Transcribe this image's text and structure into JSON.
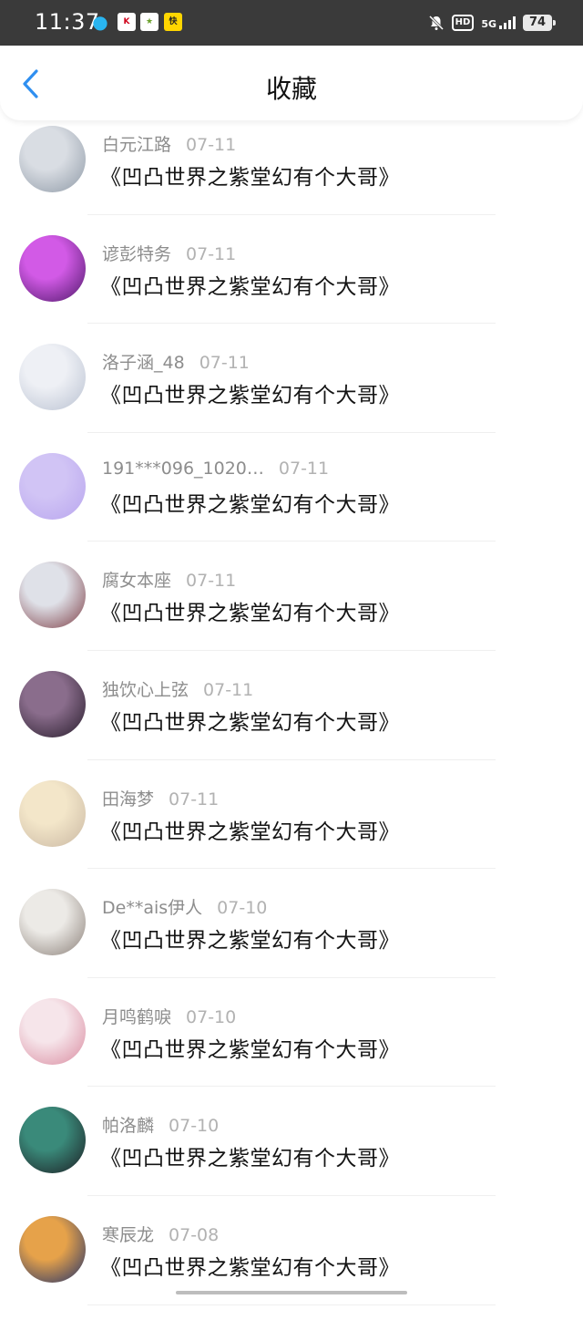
{
  "status_bar": {
    "time": "11:37",
    "network": "5G",
    "hd": "HD",
    "battery": "74"
  },
  "nav": {
    "title": "收藏"
  },
  "favorites": [
    {
      "user": "白元江路",
      "date": "07-11",
      "title": "《凹凸世界之紫堂幻有个大哥》",
      "avatar_colors": [
        "#d9dde3",
        "#8e99a6"
      ]
    },
    {
      "user": "谚彭特务",
      "date": "07-11",
      "title": "《凹凸世界之紫堂幻有个大哥》",
      "avatar_colors": [
        "#d25ae6",
        "#4d1868"
      ]
    },
    {
      "user": "洛子涵_48",
      "date": "07-11",
      "title": "《凹凸世界之紫堂幻有个大哥》",
      "avatar_colors": [
        "#eef0f5",
        "#b9c1d1"
      ]
    },
    {
      "user": "191***096_1020…",
      "date": "07-11",
      "title": "《凹凸世界之紫堂幻有个大哥》",
      "avatar_colors": [
        "#d1c4f5",
        "#b8a5ee"
      ]
    },
    {
      "user": "腐女本座",
      "date": "07-11",
      "title": "《凹凸世界之紫堂幻有个大哥》",
      "avatar_colors": [
        "#dfe1e8",
        "#7d3d45"
      ]
    },
    {
      "user": "独饮心上弦",
      "date": "07-11",
      "title": "《凹凸世界之紫堂幻有个大哥》",
      "avatar_colors": [
        "#8a6d8c",
        "#261b2a"
      ]
    },
    {
      "user": "田海梦",
      "date": "07-11",
      "title": "《凹凸世界之紫堂幻有个大哥》",
      "avatar_colors": [
        "#f3e6c9",
        "#c9b7a2"
      ]
    },
    {
      "user": "De**ais伊人",
      "date": "07-10",
      "title": "《凹凸世界之紫堂幻有个大哥》",
      "avatar_colors": [
        "#eceae6",
        "#8a7f78"
      ]
    },
    {
      "user": "月鸣鹤唳",
      "date": "07-10",
      "title": "《凹凸世界之紫堂幻有个大哥》",
      "avatar_colors": [
        "#f6e5ea",
        "#d98a9f"
      ]
    },
    {
      "user": "帕洛麟",
      "date": "07-10",
      "title": "《凹凸世界之紫堂幻有个大哥》",
      "avatar_colors": [
        "#3a8a7a",
        "#1c1c22"
      ]
    },
    {
      "user": "寒辰龙",
      "date": "07-08",
      "title": "《凹凸世界之紫堂幻有个大哥》",
      "avatar_colors": [
        "#e6a24a",
        "#1b2e6b"
      ]
    }
  ]
}
